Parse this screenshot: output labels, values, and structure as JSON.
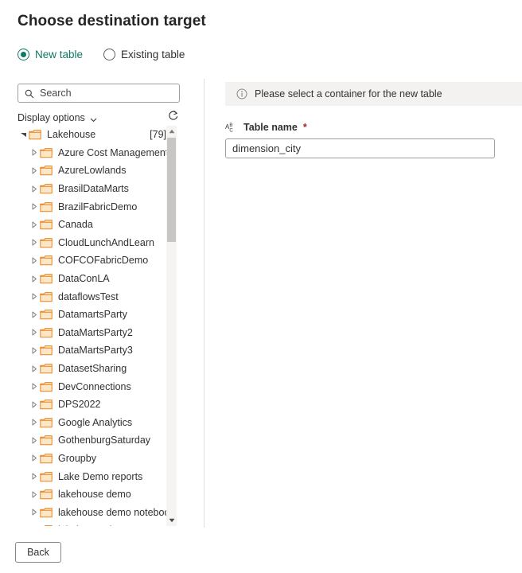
{
  "page_title": "Choose destination target",
  "accent_color": "#117865",
  "folder_icon_color": "#e8821e",
  "folder_icon_fill": "#fbe7c6",
  "destination_mode": {
    "options": [
      {
        "label": "New table",
        "selected": true
      },
      {
        "label": "Existing table",
        "selected": false
      }
    ]
  },
  "left_panel": {
    "search": {
      "placeholder": "Search",
      "value": "",
      "icon": "search-icon"
    },
    "display_options": {
      "label": "Display options",
      "chevron_icon": "chevron-down-icon"
    },
    "refresh": {
      "icon": "refresh-icon"
    },
    "tree": {
      "root": {
        "label": "Lakehouse",
        "count": "[79]",
        "expanded": true,
        "twisty_icon": "triangle-down-icon",
        "folder_icon": "folder-icon"
      },
      "items": [
        {
          "label": "Azure Cost Management ...",
          "twisty_icon": "triangle-right-icon",
          "folder_icon": "folder-icon"
        },
        {
          "label": "AzureLowlands",
          "twisty_icon": "triangle-right-icon",
          "folder_icon": "folder-icon"
        },
        {
          "label": "BrasilDataMarts",
          "twisty_icon": "triangle-right-icon",
          "folder_icon": "folder-icon"
        },
        {
          "label": "BrazilFabricDemo",
          "twisty_icon": "triangle-right-icon",
          "folder_icon": "folder-icon"
        },
        {
          "label": "Canada",
          "twisty_icon": "triangle-right-icon",
          "folder_icon": "folder-icon"
        },
        {
          "label": "CloudLunchAndLearn",
          "twisty_icon": "triangle-right-icon",
          "folder_icon": "folder-icon"
        },
        {
          "label": "COFCOFabricDemo",
          "twisty_icon": "triangle-right-icon",
          "folder_icon": "folder-icon"
        },
        {
          "label": "DataConLA",
          "twisty_icon": "triangle-right-icon",
          "folder_icon": "folder-icon"
        },
        {
          "label": "dataflowsTest",
          "twisty_icon": "triangle-right-icon",
          "folder_icon": "folder-icon"
        },
        {
          "label": "DatamartsParty",
          "twisty_icon": "triangle-right-icon",
          "folder_icon": "folder-icon"
        },
        {
          "label": "DataMartsParty2",
          "twisty_icon": "triangle-right-icon",
          "folder_icon": "folder-icon"
        },
        {
          "label": "DataMartsParty3",
          "twisty_icon": "triangle-right-icon",
          "folder_icon": "folder-icon"
        },
        {
          "label": "DatasetSharing",
          "twisty_icon": "triangle-right-icon",
          "folder_icon": "folder-icon"
        },
        {
          "label": "DevConnections",
          "twisty_icon": "triangle-right-icon",
          "folder_icon": "folder-icon"
        },
        {
          "label": "DPS2022",
          "twisty_icon": "triangle-right-icon",
          "folder_icon": "folder-icon"
        },
        {
          "label": "Google Analytics",
          "twisty_icon": "triangle-right-icon",
          "folder_icon": "folder-icon"
        },
        {
          "label": "GothenburgSaturday",
          "twisty_icon": "triangle-right-icon",
          "folder_icon": "folder-icon"
        },
        {
          "label": "Groupby",
          "twisty_icon": "triangle-right-icon",
          "folder_icon": "folder-icon"
        },
        {
          "label": "Lake Demo reports",
          "twisty_icon": "triangle-right-icon",
          "folder_icon": "folder-icon"
        },
        {
          "label": "lakehouse demo",
          "twisty_icon": "triangle-right-icon",
          "folder_icon": "folder-icon"
        },
        {
          "label": "lakehouse demo noteboo...",
          "twisty_icon": "triangle-right-icon",
          "folder_icon": "folder-icon"
        },
        {
          "label": "lakehouse demo semantic",
          "twisty_icon": "triangle-right-icon",
          "folder_icon": "folder-icon"
        }
      ]
    },
    "scrollbar": {
      "up_icon": "scroll-up-arrow-icon",
      "down_icon": "scroll-down-arrow-icon"
    }
  },
  "right_panel": {
    "info_message": {
      "icon": "info-icon",
      "text": "Please select a container for the new table"
    },
    "table_name_field": {
      "icon": "text-type-icon",
      "label": "Table name",
      "required_marker": "*",
      "value": "dimension_city",
      "placeholder": ""
    }
  },
  "footer": {
    "back_label": "Back"
  }
}
